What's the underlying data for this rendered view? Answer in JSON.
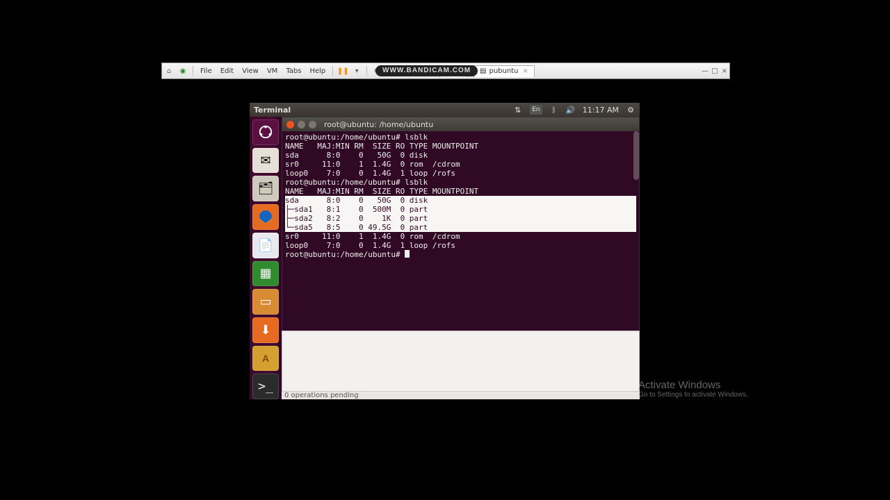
{
  "vmware": {
    "menus": [
      "File",
      "Edit",
      "View",
      "VM",
      "Tabs",
      "Help"
    ],
    "tab_label": "pubuntu",
    "tab_close": "×",
    "btn_min": "—",
    "btn_max": "□",
    "btn_close": "×"
  },
  "bandicam": "WWW.BANDICAM.COM",
  "menubar": {
    "title": "Terminal",
    "lang": "En",
    "time": "11:17 AM"
  },
  "launcher": {
    "dash": "dash",
    "mail": "✉",
    "files": "🗂",
    "doc": "📄",
    "calc": "▦",
    "imp": "▭",
    "sw": "⬇",
    "az": "A",
    "term": ">_"
  },
  "terminal": {
    "title": "root@ubuntu: /home/ubuntu",
    "lines": [
      "root@ubuntu:/home/ubuntu# lsblk",
      "NAME   MAJ:MIN RM  SIZE RO TYPE MOUNTPOINT",
      "sda      8:0    0   50G  0 disk ",
      "sr0     11:0    1  1.4G  0 rom  /cdrom",
      "loop0    7:0    0  1.4G  1 loop /rofs",
      "root@ubuntu:/home/ubuntu# lsblk",
      "NAME   MAJ:MIN RM  SIZE RO TYPE MOUNTPOINT"
    ],
    "selected": [
      "sda      8:0    0   50G  0 disk ",
      "├─sda1   8:1    0  500M  0 part ",
      "├─sda2   8:2    0    1K  0 part ",
      "└─sda5   8:5    0 49.5G  0 part "
    ],
    "after": [
      "sr0     11:0    1  1.4G  0 rom  /cdrom",
      "loop0    7:0    0  1.4G  1 loop /rofs"
    ],
    "prompt": "root@ubuntu:/home/ubuntu# "
  },
  "status": "0 operations pending",
  "watermark": {
    "l1": "Activate Windows",
    "l2": "Go to Settings to activate Windows."
  }
}
